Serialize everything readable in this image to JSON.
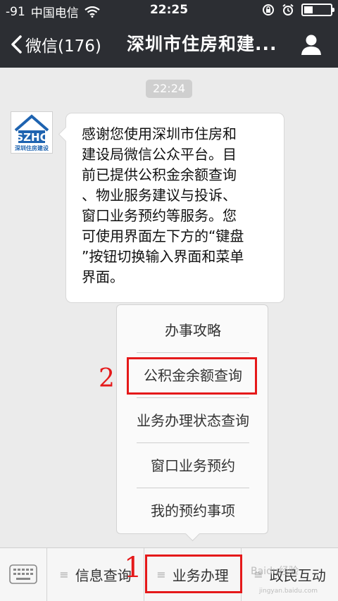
{
  "status_bar": {
    "signal": "-91",
    "carrier": "中国电信",
    "time": "22:25"
  },
  "nav": {
    "back_label": "微信(176)",
    "title": "深圳市住房和建..."
  },
  "chat": {
    "timestamp": "22:24",
    "avatar_text": "SZHC",
    "avatar_subtext": "深圳住房建设",
    "message_lines": [
      "感谢您使用深圳市住房和",
      "建设局微信公众平台。目",
      "前已提供公积金余额查询",
      "、物业服务建议与投诉、",
      "窗口业务预约等服务。您",
      "可使用界面左下方的“键盘",
      "”按钮切换输入界面和菜单",
      "界面。"
    ]
  },
  "menu_popup": {
    "items": [
      {
        "label": "办事攻略"
      },
      {
        "label": "公积金余额查询"
      },
      {
        "label": "业务办理状态查询"
      },
      {
        "label": "窗口业务预约"
      },
      {
        "label": "我的预约事项"
      }
    ]
  },
  "toolbar": {
    "tabs": [
      {
        "label": "信息查询"
      },
      {
        "label": "业务办理"
      },
      {
        "label": "政民互动"
      }
    ]
  },
  "annotations": {
    "step1": "1",
    "step2": "2",
    "color": "#e5191a"
  },
  "watermark": {
    "text": "Baidu经验",
    "sub": "jingyan.baidu.com"
  }
}
